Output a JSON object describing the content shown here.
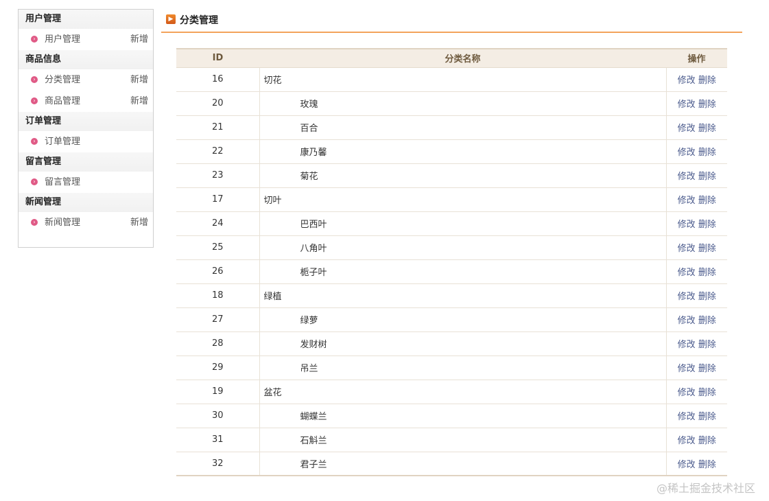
{
  "sidebar": {
    "sections": [
      {
        "title": "用户管理",
        "items": [
          {
            "label": "用户管理",
            "action": "新增"
          }
        ]
      },
      {
        "title": "商品信息",
        "items": [
          {
            "label": "分类管理",
            "action": "新增"
          },
          {
            "label": "商品管理",
            "action": "新增"
          }
        ]
      },
      {
        "title": "订单管理",
        "items": [
          {
            "label": "订单管理",
            "action": ""
          }
        ]
      },
      {
        "title": "留言管理",
        "items": [
          {
            "label": "留言管理",
            "action": ""
          }
        ]
      },
      {
        "title": "新闻管理",
        "items": [
          {
            "label": "新闻管理",
            "action": "新增"
          }
        ]
      }
    ]
  },
  "header": {
    "title": "分类管理"
  },
  "table": {
    "headers": {
      "id": "ID",
      "name": "分类名称",
      "op": "操作"
    },
    "edit_label": "修改",
    "delete_label": "删除",
    "rows": [
      {
        "id": "16",
        "name": "切花",
        "child": false
      },
      {
        "id": "20",
        "name": "玫瑰",
        "child": true
      },
      {
        "id": "21",
        "name": "百合",
        "child": true
      },
      {
        "id": "22",
        "name": "康乃馨",
        "child": true
      },
      {
        "id": "23",
        "name": "菊花",
        "child": true
      },
      {
        "id": "17",
        "name": "切叶",
        "child": false
      },
      {
        "id": "24",
        "name": "巴西叶",
        "child": true
      },
      {
        "id": "25",
        "name": "八角叶",
        "child": true
      },
      {
        "id": "26",
        "name": "栀子叶",
        "child": true
      },
      {
        "id": "18",
        "name": "绿植",
        "child": false
      },
      {
        "id": "27",
        "name": "绿萝",
        "child": true
      },
      {
        "id": "28",
        "name": "发财树",
        "child": true
      },
      {
        "id": "29",
        "name": "吊兰",
        "child": true
      },
      {
        "id": "19",
        "name": "盆花",
        "child": false
      },
      {
        "id": "30",
        "name": "蝴蝶兰",
        "child": true
      },
      {
        "id": "31",
        "name": "石斛兰",
        "child": true
      },
      {
        "id": "32",
        "name": "君子兰",
        "child": true
      }
    ]
  },
  "watermark": "@稀土掘金技术社区"
}
